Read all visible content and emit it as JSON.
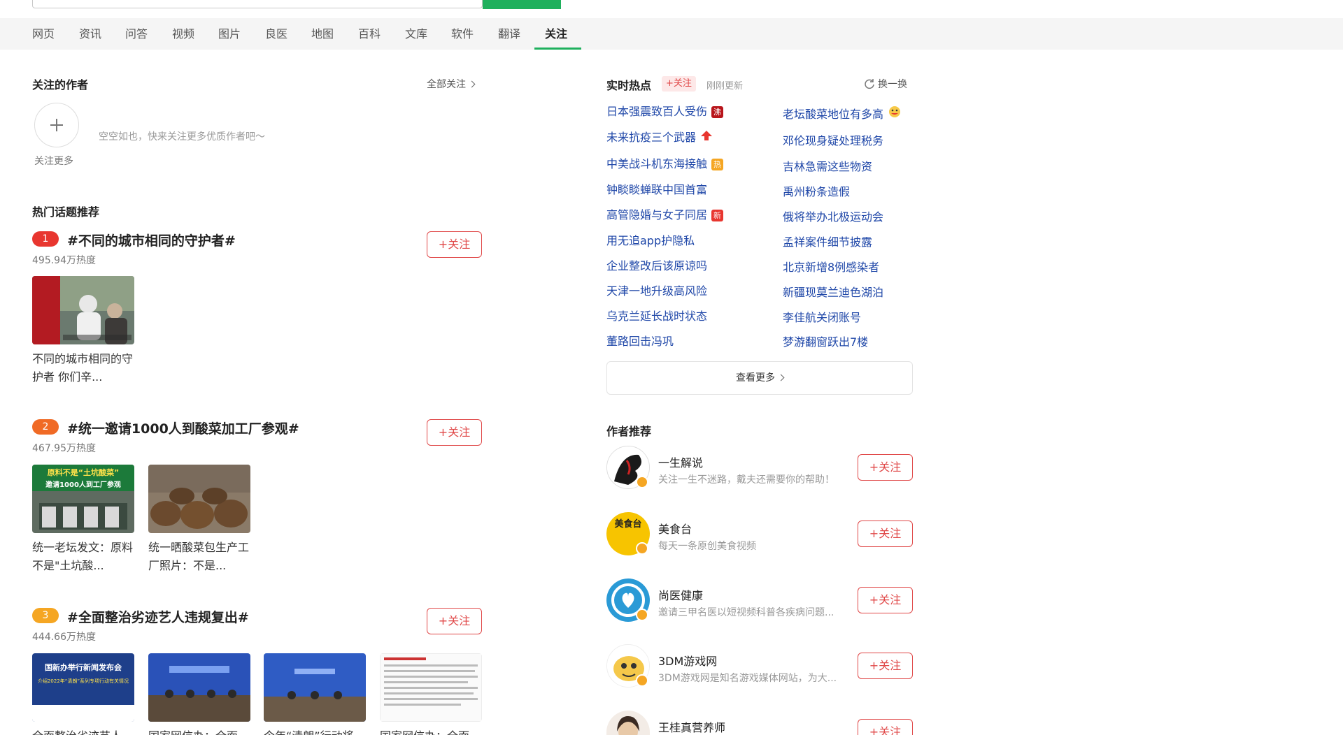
{
  "nav": {
    "items": [
      "网页",
      "资讯",
      "问答",
      "视频",
      "图片",
      "良医",
      "地图",
      "百科",
      "文库",
      "软件",
      "翻译",
      "关注"
    ],
    "active_index": 11
  },
  "follow_authors": {
    "title": "关注的作者",
    "all_link": "全部关注",
    "add_more": "关注更多",
    "empty_tip": "空空如也，快来关注更多优质作者吧～"
  },
  "hot_topics": {
    "title": "热门话题推荐",
    "follow_label": "+关注",
    "rank_colors": [
      "#e8362f",
      "#f06a25",
      "#f5a623"
    ],
    "topics": [
      {
        "rank": "1",
        "title": "#不同的城市相同的守护者#",
        "heat": "495.94万热度",
        "items": [
          {
            "caption": "不同的城市相同的守护者 你们辛..."
          }
        ]
      },
      {
        "rank": "2",
        "title": "#统一邀请1000人到酸菜加工厂参观#",
        "heat": "467.95万热度",
        "items": [
          {
            "caption": "统一老坛发文：原料不是\"土坑酸...",
            "overlay_line1": "原料不是“土坑酸菜”",
            "overlay_line2": "邀请1000人到工厂参观"
          },
          {
            "caption": "统一晒酸菜包生产工厂照片：不是..."
          }
        ]
      },
      {
        "rank": "3",
        "title": "#全面整治劣迹艺人违规复出#",
        "heat": "444.66万热度",
        "items": [
          {
            "caption": "全面整治劣迹艺人...",
            "overlay_line1": "国新办举行新闻发布会",
            "overlay_line2": "介绍2022年“清朗”系列专项行动有关情况"
          },
          {
            "caption": "国家网信办：全面..."
          },
          {
            "caption": "今年“清朗”行动将从..."
          },
          {
            "caption": "国家网信办：全面..."
          }
        ]
      }
    ]
  },
  "realtime_hot": {
    "title": "实时热点",
    "follow_label": "+关注",
    "updated": "刚刚更新",
    "refresh": "换一换",
    "left": [
      {
        "text": "日本强震致百人受伤",
        "badge": "沸",
        "badge_color": "#b8151b"
      },
      {
        "text": "未来抗疫三个武器",
        "badge": "up-arrow",
        "badge_color": "#e8362f"
      },
      {
        "text": "中美战斗机东海接触",
        "badge": "热",
        "badge_color": "#f5a623"
      },
      {
        "text": "钟睒睒蝉联中国首富",
        "badge": ""
      },
      {
        "text": "高管隐婚与女子同居",
        "badge": "新",
        "badge_color": "#e8362f"
      },
      {
        "text": "用无追app护隐私",
        "badge": ""
      },
      {
        "text": "企业整改后该原谅吗",
        "badge": ""
      },
      {
        "text": "天津一地升级高风险",
        "badge": ""
      },
      {
        "text": "乌克兰延长战时状态",
        "badge": ""
      },
      {
        "text": "董路回击冯巩",
        "badge": ""
      }
    ],
    "right": [
      {
        "text": "老坛酸菜地位有多高",
        "badge": "emoji"
      },
      {
        "text": "邓伦现身疑处理税务",
        "badge": ""
      },
      {
        "text": "吉林急需这些物资",
        "badge": ""
      },
      {
        "text": "禹州粉条造假",
        "badge": ""
      },
      {
        "text": "俄将举办北极运动会",
        "badge": ""
      },
      {
        "text": "孟祥案件细节披露",
        "badge": ""
      },
      {
        "text": "北京新增8例感染者",
        "badge": ""
      },
      {
        "text": "新疆现莫兰迪色湖泊",
        "badge": ""
      },
      {
        "text": "李佳航关闭账号",
        "badge": ""
      },
      {
        "text": "梦游翻窗跃出7楼",
        "badge": ""
      }
    ],
    "see_more": "查看更多"
  },
  "author_recs": {
    "title": "作者推荐",
    "follow_label": "+关注",
    "authors": [
      {
        "name": "一生解说",
        "desc": "关注一生不迷路，戴夫还需要你的帮助！"
      },
      {
        "name": "美食台",
        "desc": "每天一条原创美食视频",
        "avatar_text": "美食台"
      },
      {
        "name": "尚医健康",
        "desc": "邀请三甲名医以短视频科普各疾病问题..."
      },
      {
        "name": "3DM游戏网",
        "desc": "3DM游戏网是知名游戏媒体网站，为大..."
      },
      {
        "name": "王桂真营养师",
        "desc": ""
      }
    ]
  }
}
